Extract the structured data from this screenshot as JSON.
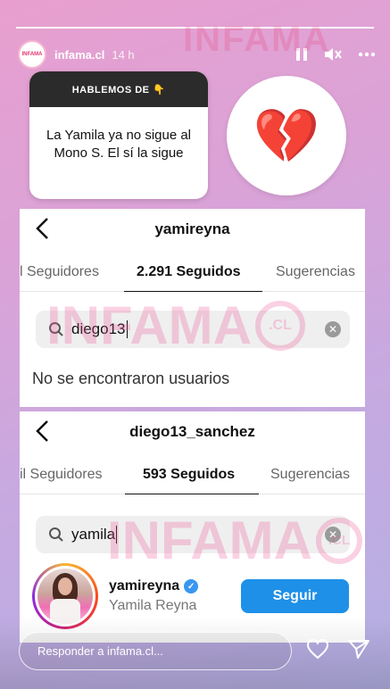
{
  "story": {
    "username": "infama.cl",
    "time": "14 h",
    "avatar_text": "INFAMA",
    "progress_fraction": 1.0,
    "segments": 1
  },
  "watermark": {
    "text": "INFAMA",
    "suffix": ".CL"
  },
  "sticker": {
    "header": "HABLEMOS DE 👇",
    "body": "La Yamila ya no sigue al Mono S. El sí la sigue",
    "emoji": "💔"
  },
  "panel1": {
    "title": "yamireyna",
    "tabs": [
      "l Seguidores",
      "2.291 Seguidos",
      "Sugerencias"
    ],
    "search_value": "diego13",
    "no_results": "No se encontraron usuarios"
  },
  "panel2": {
    "title": "diego13_sanchez",
    "tabs": [
      "il Seguidores",
      "593 Seguidos",
      "Sugerencias"
    ],
    "search_value": "yamila",
    "user": {
      "handle": "yamireyna",
      "full_name": "Yamila Reyna",
      "verified": true,
      "button": "Seguir"
    }
  },
  "reply": {
    "placeholder": "Responder a infama.cl..."
  },
  "colors": {
    "follow_button": "#1e90e8",
    "watermark": "#ea3c78"
  }
}
